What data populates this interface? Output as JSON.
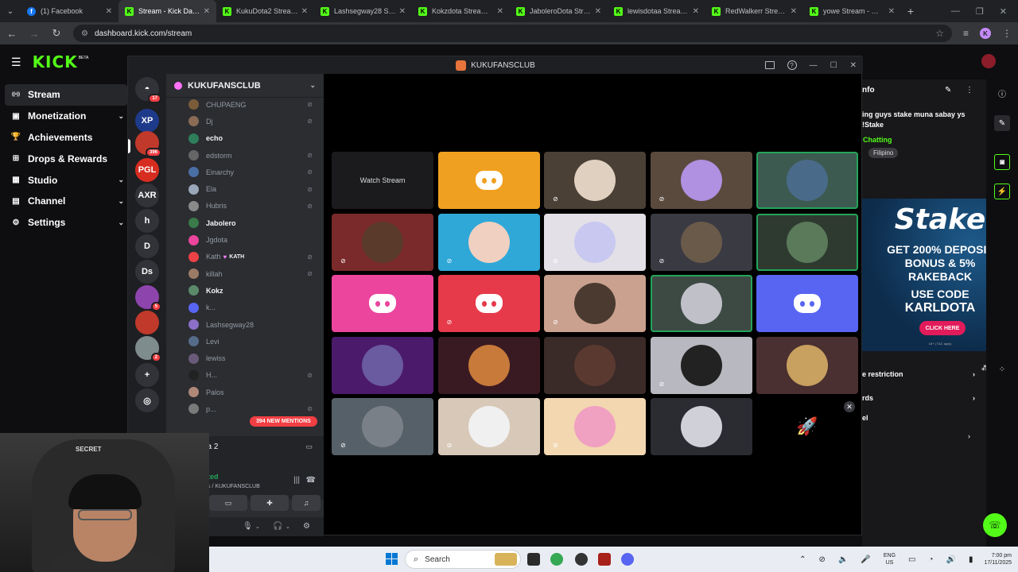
{
  "browser": {
    "tabs": [
      {
        "title": "(1) Facebook",
        "favicon": "facebook-icon",
        "active": false
      },
      {
        "title": "Stream - Kick Dashbo",
        "favicon": "kick-icon",
        "active": true
      },
      {
        "title": "KukuDota2 Stream - ",
        "favicon": "kick-icon",
        "active": false
      },
      {
        "title": "Lashsegway28 Stream",
        "favicon": "kick-icon",
        "active": false
      },
      {
        "title": "Kokzdota Stream - W",
        "favicon": "kick-icon",
        "active": false
      },
      {
        "title": "JaboleroDota Stream",
        "favicon": "kick-icon",
        "active": false
      },
      {
        "title": "lewisdotaa Stream - ",
        "favicon": "kick-icon",
        "active": false
      },
      {
        "title": "RedWalkerr Stream - ",
        "favicon": "kick-icon",
        "active": false
      },
      {
        "title": "yowe Stream - Watc",
        "favicon": "kick-icon",
        "active": false
      }
    ],
    "url": "dashboard.kick.com/stream",
    "profile_initial": "K"
  },
  "kick": {
    "logo": "KICK",
    "logo_badge": "BETA",
    "nav": [
      {
        "label": "Stream",
        "icon": "stream-icon",
        "active": true,
        "expandable": false
      },
      {
        "label": "Monetization",
        "icon": "monetization-icon",
        "active": false,
        "expandable": true
      },
      {
        "label": "Achievements",
        "icon": "trophy-icon",
        "active": false,
        "expandable": false
      },
      {
        "label": "Drops & Rewards",
        "icon": "gift-icon",
        "active": false,
        "expandable": false
      },
      {
        "label": "Studio",
        "icon": "studio-icon",
        "active": false,
        "expandable": true
      },
      {
        "label": "Channel",
        "icon": "channel-icon",
        "active": false,
        "expandable": true
      },
      {
        "label": "Settings",
        "icon": "gear-icon",
        "active": false,
        "expandable": true
      }
    ],
    "right_panel": {
      "title": "nfo",
      "stream_title": "ing guys stake muna sabay ys !Stake",
      "category": "Chatting",
      "language": "Filipino",
      "rows": [
        "e restriction",
        "rds",
        "el"
      ]
    },
    "ad": {
      "brand": "Stake",
      "line1": "GET 200% DEPOSIT",
      "line2": "BONUS & 5%",
      "line3": "RAKEBACK",
      "code1": "USE CODE",
      "code2": "KARLDOTA",
      "cta": "CLICK HERE",
      "fine": "18+ | T&C apply"
    }
  },
  "discord": {
    "window_title": "KUKUFANSCLUB",
    "guild_name": "KUKUFANSCLUB",
    "servers": [
      {
        "label": "",
        "color": "#5865f2",
        "badge": "17",
        "icon": "discord-home-icon"
      },
      {
        "label": "XP",
        "color": "#1e3a8a",
        "badge": "",
        "icon": "xp-server-icon"
      },
      {
        "label": "",
        "color": "#c0392b",
        "badge": "396",
        "icon": "kukufansclub-server-icon"
      },
      {
        "label": "PGL",
        "color": "#d62d20",
        "badge": "",
        "icon": "pgl-server-icon"
      },
      {
        "label": "AXR",
        "color": "#313338",
        "badge": "",
        "icon": ""
      },
      {
        "label": "h",
        "color": "#313338",
        "badge": "",
        "icon": ""
      },
      {
        "label": "D",
        "color": "#313338",
        "badge": "",
        "icon": ""
      },
      {
        "label": "Ds",
        "color": "#313338",
        "badge": "",
        "icon": ""
      },
      {
        "label": "",
        "color": "#8e44ad",
        "badge": "5",
        "icon": "server-avatar-icon"
      },
      {
        "label": "",
        "color": "#c0392b",
        "badge": "",
        "icon": "server-avatar-icon"
      },
      {
        "label": "",
        "color": "#7f8c8d",
        "badge": "2",
        "icon": "server-avatar-icon"
      },
      {
        "label": "+",
        "color": "#313338",
        "badge": "",
        "icon": "add-server-icon"
      },
      {
        "label": "",
        "color": "#313338",
        "badge": "",
        "icon": "discover-icon"
      }
    ],
    "members": [
      {
        "name": "CHUPAENG",
        "bold": false,
        "muted": true,
        "color": "#7a5c3a"
      },
      {
        "name": "Dj",
        "bold": false,
        "muted": true,
        "color": "#8b6b55"
      },
      {
        "name": "echo",
        "bold": true,
        "muted": false,
        "color": "#2e7d5b"
      },
      {
        "name": "edstorm",
        "bold": false,
        "muted": true,
        "color": "#666666"
      },
      {
        "name": "Einarchy",
        "bold": false,
        "muted": true,
        "color": "#4a6fa5"
      },
      {
        "name": "Ela",
        "bold": false,
        "muted": true,
        "color": "#9aa7b8"
      },
      {
        "name": "Hubris",
        "bold": false,
        "muted": true,
        "color": "#8a8a8a"
      },
      {
        "name": "Jabolero",
        "bold": true,
        "muted": false,
        "color": "#3b7a4a"
      },
      {
        "name": "Jgdota",
        "bold": false,
        "muted": false,
        "color": "#eb459e"
      },
      {
        "name": "Kath",
        "bold": false,
        "muted": true,
        "color": "#ed4245",
        "tag": "KATH"
      },
      {
        "name": "killah",
        "bold": false,
        "muted": true,
        "color": "#9b7b66"
      },
      {
        "name": "Kokz",
        "bold": true,
        "muted": false,
        "color": "#5a8a6a"
      },
      {
        "name": "k...",
        "bold": false,
        "muted": false,
        "color": "#5865f2"
      },
      {
        "name": "Lashsegway28",
        "bold": false,
        "muted": false,
        "color": "#8c6fc6"
      },
      {
        "name": "Levi",
        "bold": false,
        "muted": false,
        "color": "#556b8a"
      },
      {
        "name": "lewiss",
        "bold": false,
        "muted": false,
        "color": "#6a5a7a"
      },
      {
        "name": "H...",
        "bold": false,
        "muted": true,
        "color": "#222222"
      },
      {
        "name": "Palos",
        "bold": false,
        "muted": false,
        "color": "#b08878"
      },
      {
        "name": "p...",
        "bold": false,
        "muted": true,
        "color": "#7a7a7a"
      }
    ],
    "new_mentions": "394 NEW MENTIONS",
    "activity": "Dota 2",
    "voice_status": "ted",
    "voice_channel": "s / KUKUFANSCLUB",
    "grid": [
      {
        "kind": "watch",
        "label": "Watch Stream",
        "bg": "#1b1b1d",
        "mic_muted": false,
        "speaking": false
      },
      {
        "kind": "discord",
        "bg": "#f0a020",
        "mic_muted": false,
        "speaking": false
      },
      {
        "kind": "avatar",
        "bg": "#4a4035",
        "avatar": "#e0d0c0",
        "mic_muted": true,
        "speaking": false
      },
      {
        "kind": "avatar",
        "bg": "#5a4a3e",
        "avatar": "#b090e0",
        "mic_muted": true,
        "speaking": false
      },
      {
        "kind": "avatar",
        "bg": "#3c5a50",
        "avatar": "#4a6a8a",
        "mic_muted": false,
        "speaking": true
      },
      {
        "kind": "avatar",
        "bg": "#7a2a2a",
        "avatar": "#5a3a2a",
        "mic_muted": true,
        "speaking": false
      },
      {
        "kind": "avatar",
        "bg": "#2fa8d8",
        "avatar": "#f0d0c0",
        "mic_muted": true,
        "speaking": false
      },
      {
        "kind": "avatar",
        "bg": "#e4e0e8",
        "avatar": "#c8c8f0",
        "mic_muted": true,
        "speaking": false
      },
      {
        "kind": "avatar",
        "bg": "#3a3a42",
        "avatar": "#6a5a4a",
        "mic_muted": true,
        "speaking": false
      },
      {
        "kind": "avatar",
        "bg": "#2e3a30",
        "avatar": "#5a7a5a",
        "mic_muted": false,
        "speaking": true
      },
      {
        "kind": "discord",
        "bg": "#eb459e",
        "mic_muted": false,
        "speaking": false
      },
      {
        "kind": "discord",
        "bg": "#e63a4a",
        "mic_muted": true,
        "speaking": false
      },
      {
        "kind": "avatar",
        "bg": "#caa08e",
        "avatar": "#4a3a30",
        "mic_muted": true,
        "speaking": false
      },
      {
        "kind": "avatar",
        "bg": "#3d4a44",
        "avatar": "#c0c0c8",
        "mic_muted": false,
        "speaking": true
      },
      {
        "kind": "discord",
        "bg": "#5865f2",
        "mic_muted": false,
        "speaking": false
      },
      {
        "kind": "avatar",
        "bg": "#4b1a6a",
        "avatar": "#6a5aa0",
        "mic_muted": false,
        "speaking": false
      },
      {
        "kind": "avatar",
        "bg": "#3a1a22",
        "avatar": "#c87a3a",
        "mic_muted": false,
        "speaking": false
      },
      {
        "kind": "avatar",
        "bg": "#3a2a28",
        "avatar": "#5a3a30",
        "mic_muted": false,
        "speaking": false
      },
      {
        "kind": "avatar",
        "bg": "#b8b8c0",
        "avatar": "#222222",
        "mic_muted": true,
        "speaking": false
      },
      {
        "kind": "avatar",
        "bg": "#4a3030",
        "avatar": "#c8a060",
        "mic_muted": false,
        "speaking": false
      },
      {
        "kind": "avatar",
        "bg": "#566068",
        "avatar": "#7a8088",
        "mic_muted": true,
        "speaking": false
      },
      {
        "kind": "avatar",
        "bg": "#d8c8b8",
        "avatar": "#f0f0f0",
        "mic_muted": true,
        "speaking": false
      },
      {
        "kind": "avatar",
        "bg": "#f2d7b0",
        "avatar": "#f0a0c0",
        "mic_muted": true,
        "speaking": false
      },
      {
        "kind": "avatar",
        "bg": "#2a2c32",
        "avatar": "#d0d0d8",
        "mic_muted": false,
        "speaking": false
      },
      {
        "kind": "empty",
        "bg": "#000000",
        "mic_muted": false,
        "speaking": false
      }
    ]
  },
  "webcam": {
    "brand": "SECRET"
  },
  "taskbar": {
    "search_placeholder": "Search",
    "lang_top": "ENG",
    "lang_bottom": "US",
    "time": "7:00 pm",
    "date": "17/11/2025"
  }
}
